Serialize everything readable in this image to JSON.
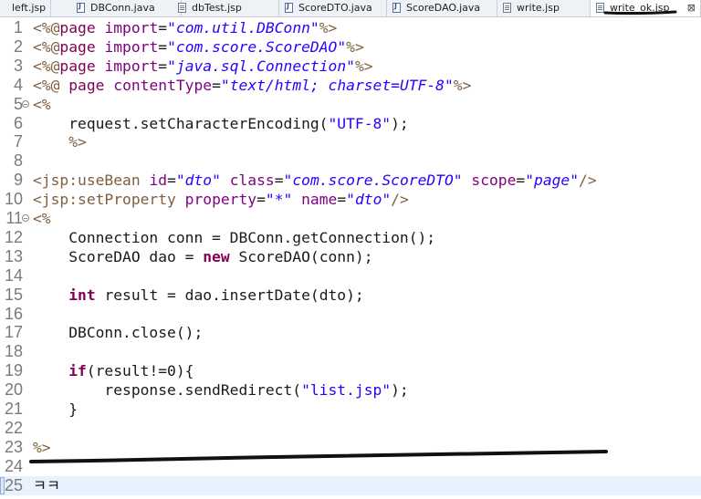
{
  "tabs": [
    {
      "label": "left.jsp",
      "icon": "jsp-file-icon",
      "active": false
    },
    {
      "label": "DBConn.java",
      "icon": "java-file-icon",
      "active": false
    },
    {
      "label": "dbTest.jsp",
      "icon": "jsp-file-icon",
      "active": false
    },
    {
      "label": "ScoreDTO.java",
      "icon": "java-file-icon",
      "active": false
    },
    {
      "label": "ScoreDAO.java",
      "icon": "java-file-icon",
      "active": false
    },
    {
      "label": "write.jsp",
      "icon": "jsp-file-icon",
      "active": false
    },
    {
      "label": "write_ok.jsp",
      "icon": "jsp-file-icon",
      "active": true,
      "close": "⊠"
    }
  ],
  "colors": {
    "tag": "#7f5f3f",
    "keyword": "#7f0055",
    "attr": "#7f007f",
    "string": "#2a00ff",
    "text": "#1a1a1a",
    "current_line": "#e8f2fe"
  },
  "lines": [
    {
      "n": "1",
      "parts": [
        [
          "tag",
          "<%@"
        ],
        [
          "kw",
          "page"
        ],
        [
          "t",
          " "
        ],
        [
          "attr",
          "import"
        ],
        [
          "t",
          "="
        ],
        [
          "str",
          "\"com.util.DBConn\""
        ],
        [
          "tag",
          "%>"
        ]
      ]
    },
    {
      "n": "2",
      "parts": [
        [
          "tag",
          "<%@"
        ],
        [
          "kw",
          "page"
        ],
        [
          "t",
          " "
        ],
        [
          "attr",
          "import"
        ],
        [
          "t",
          "="
        ],
        [
          "str",
          "\"com.score.ScoreDAO\""
        ],
        [
          "tag",
          "%>"
        ]
      ]
    },
    {
      "n": "3",
      "parts": [
        [
          "tag",
          "<%@"
        ],
        [
          "kw",
          "page"
        ],
        [
          "t",
          " "
        ],
        [
          "attr",
          "import"
        ],
        [
          "t",
          "="
        ],
        [
          "str",
          "\"java.sql.Connection\""
        ],
        [
          "tag",
          "%>"
        ]
      ]
    },
    {
      "n": "4",
      "parts": [
        [
          "tag",
          "<%@"
        ],
        [
          "t",
          " "
        ],
        [
          "kw",
          "page"
        ],
        [
          "t",
          " "
        ],
        [
          "attr",
          "contentType"
        ],
        [
          "t",
          "="
        ],
        [
          "str",
          "\"text/html; charset=UTF-8\""
        ],
        [
          "tag",
          "%>"
        ]
      ]
    },
    {
      "n": "5",
      "fold": true,
      "parts": [
        [
          "tag",
          "<%"
        ]
      ]
    },
    {
      "n": "6",
      "parts": [
        [
          "t",
          "    request.setCharacterEncoding("
        ],
        [
          "str",
          "\"UTF-8\""
        ],
        [
          "t",
          ");"
        ]
      ]
    },
    {
      "n": "7",
      "parts": [
        [
          "t",
          "    "
        ],
        [
          "tag",
          "%>"
        ]
      ]
    },
    {
      "n": "8",
      "parts": []
    },
    {
      "n": "9",
      "parts": [
        [
          "tag",
          "<jsp:useBean"
        ],
        [
          "t",
          " "
        ],
        [
          "attr",
          "id"
        ],
        [
          "t",
          "="
        ],
        [
          "str",
          "\"dto\""
        ],
        [
          "t",
          " "
        ],
        [
          "attr",
          "class"
        ],
        [
          "t",
          "="
        ],
        [
          "str",
          "\"com.score.ScoreDTO\""
        ],
        [
          "t",
          " "
        ],
        [
          "attr",
          "scope"
        ],
        [
          "t",
          "="
        ],
        [
          "str",
          "\"page\""
        ],
        [
          "tag",
          "/>"
        ]
      ]
    },
    {
      "n": "10",
      "parts": [
        [
          "tag",
          "<jsp:setProperty"
        ],
        [
          "t",
          " "
        ],
        [
          "attr",
          "property"
        ],
        [
          "t",
          "="
        ],
        [
          "str",
          "\"*\""
        ],
        [
          "t",
          " "
        ],
        [
          "attr",
          "name"
        ],
        [
          "t",
          "="
        ],
        [
          "str",
          "\"dto\""
        ],
        [
          "tag",
          "/>"
        ]
      ]
    },
    {
      "n": "11",
      "fold": true,
      "parts": [
        [
          "tag",
          "<%"
        ]
      ]
    },
    {
      "n": "12",
      "parts": [
        [
          "t",
          "    Connection conn = DBConn.getConnection();"
        ]
      ]
    },
    {
      "n": "13",
      "parts": [
        [
          "t",
          "    ScoreDAO dao = "
        ],
        [
          "kw",
          "new"
        ],
        [
          "t",
          " ScoreDAO(conn);"
        ]
      ]
    },
    {
      "n": "14",
      "parts": []
    },
    {
      "n": "15",
      "parts": [
        [
          "t",
          "    "
        ],
        [
          "kw",
          "int"
        ],
        [
          "t",
          " result = dao.insertDate(dto);"
        ]
      ]
    },
    {
      "n": "16",
      "parts": []
    },
    {
      "n": "17",
      "parts": [
        [
          "t",
          "    DBConn.close();"
        ]
      ]
    },
    {
      "n": "18",
      "parts": []
    },
    {
      "n": "19",
      "parts": [
        [
          "t",
          "    "
        ],
        [
          "kw",
          "if"
        ],
        [
          "t",
          "(result!=0){"
        ]
      ]
    },
    {
      "n": "20",
      "parts": [
        [
          "t",
          "        response.sendRedirect("
        ],
        [
          "str",
          "\"list.jsp\""
        ],
        [
          "t",
          ");"
        ]
      ]
    },
    {
      "n": "21",
      "parts": [
        [
          "t",
          "    }"
        ]
      ]
    },
    {
      "n": "22",
      "parts": []
    },
    {
      "n": "23",
      "parts": [
        [
          "tag",
          "%>"
        ]
      ]
    },
    {
      "n": "24",
      "parts": []
    },
    {
      "n": "25",
      "current": true,
      "parts": [
        [
          "t",
          "ㅋㅋ"
        ]
      ]
    }
  ]
}
